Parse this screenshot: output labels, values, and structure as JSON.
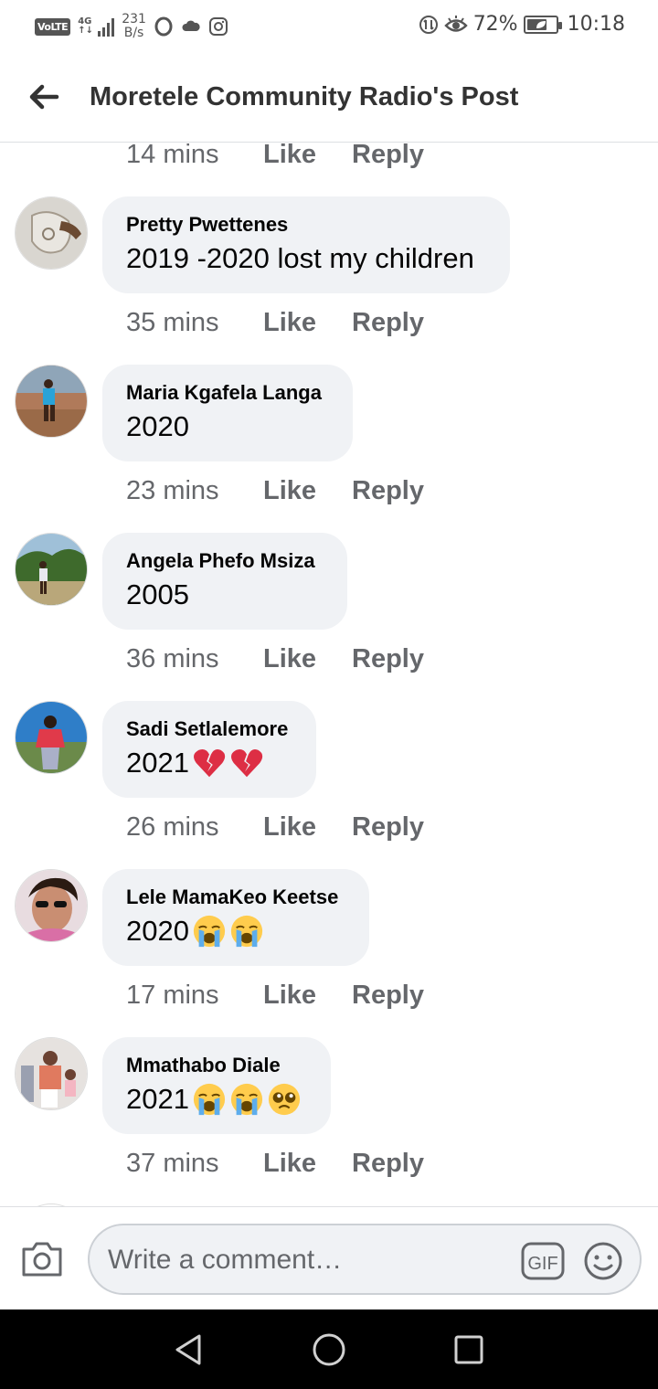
{
  "status_bar": {
    "volte": "VoLTE",
    "network": "4G",
    "speed_value": "231",
    "speed_unit": "B/s",
    "battery_percent": "72%",
    "time": "10:18"
  },
  "header": {
    "title": "Moretele Community Radio's Post"
  },
  "actions": {
    "like": "Like",
    "reply": "Reply"
  },
  "top_meta": {
    "time": "14 mins"
  },
  "comments": [
    {
      "author": "Pretty Pwettenes",
      "text": "2019 -2020 lost my children",
      "time": "35 mins",
      "emojis": []
    },
    {
      "author": "Maria Kgafela Langa",
      "text": "2020",
      "time": "23 mins",
      "emojis": []
    },
    {
      "author": "Angela Phefo Msiza",
      "text": "2005",
      "time": "36 mins",
      "emojis": []
    },
    {
      "author": "Sadi Setlalemore",
      "text": "2021",
      "time": "26 mins",
      "emojis": [
        "broken-heart-emoji",
        "broken-heart-emoji"
      ]
    },
    {
      "author": "Lele MamaKeo Keetse",
      "text": "2020",
      "time": "17 mins",
      "emojis": [
        "loudly-crying-emoji",
        "loudly-crying-emoji"
      ]
    },
    {
      "author": "Mmathabo Diale",
      "text": "2021",
      "time": "37 mins",
      "emojis": [
        "loudly-crying-emoji",
        "loudly-crying-emoji",
        "pleading-face-emoji"
      ]
    }
  ],
  "composer": {
    "placeholder": "Write a comment…",
    "gif_label": "GIF"
  },
  "icons": {
    "back": "back-arrow-icon",
    "camera": "camera-icon",
    "gif": "gif-icon",
    "emoji": "smiley-icon",
    "nav_back": "nav-back-icon",
    "nav_home": "nav-home-icon",
    "nav_recent": "nav-recent-apps-icon"
  },
  "colors": {
    "bubble": "#f0f2f5",
    "meta_text": "#65676b",
    "header_text": "#333333"
  }
}
